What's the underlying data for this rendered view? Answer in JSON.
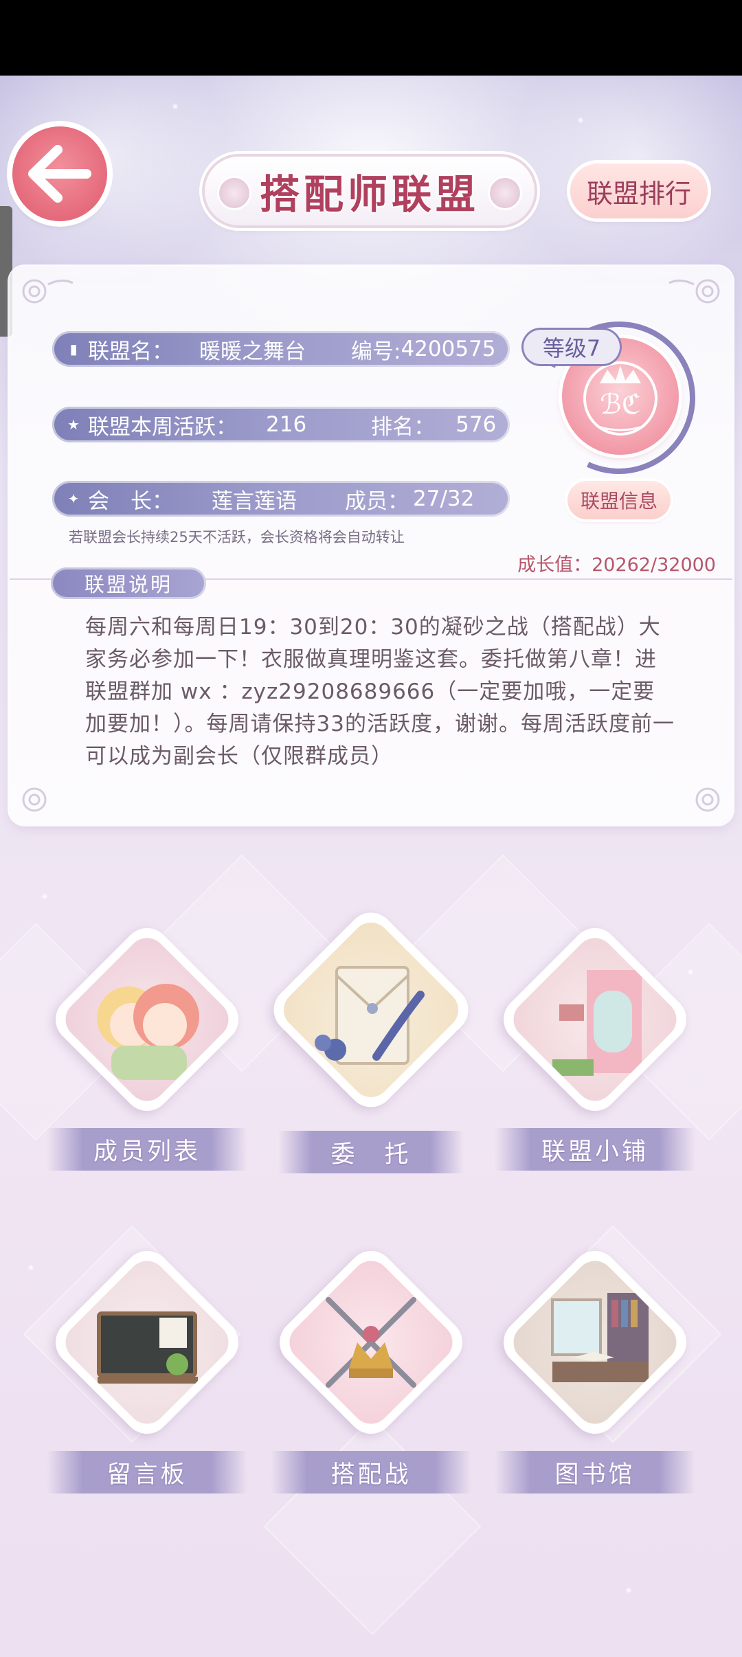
{
  "header": {
    "title": "搭配师联盟",
    "rank_button": "联盟排行"
  },
  "alliance": {
    "name_label": "联盟名：",
    "name": "暖暖之舞台",
    "id_label": "编号:",
    "id": "4200575",
    "activity_label": "联盟本周活跃：",
    "activity": "216",
    "rank_label": "排名：",
    "rank": "576",
    "leader_label": "会　长：",
    "leader": "莲言莲语",
    "members_label": "成员：",
    "members": "27/32",
    "level": "等级7",
    "info_button": "联盟信息",
    "warning": "若联盟会长持续25天不活跃，会长资格将会自动转让",
    "growth": "成长值：20262/32000"
  },
  "description": {
    "tag": "联盟说明",
    "text": "每周六和每周日19：30到20：30的凝砂之战（搭配战）大家务必参加一下！衣服做真理明鉴这套。委托做第八章！进联盟群加 wx ：zyz29208689666（一定要加哦，一定要加要加！）。每周请保持33的活跃度，谢谢。每周活跃度前一可以成为副会长（仅限群成员）"
  },
  "tiles": {
    "members": "成员列表",
    "commission": "委　托",
    "shop": "联盟小铺",
    "board": "留言板",
    "battle": "搭配战",
    "library": "图书馆"
  },
  "colors": {
    "accent": "#b0405e",
    "pill": "#8f8dc2",
    "back_button": "#e56a7b"
  }
}
